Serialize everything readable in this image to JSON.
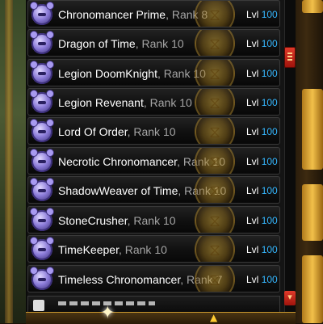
{
  "friends_list": {
    "items": [
      {
        "name": "Chronomancer Prime",
        "rank": "Rank 8",
        "level_label": "Lvl",
        "level": "100"
      },
      {
        "name": "Dragon of Time",
        "rank": "Rank 10",
        "level_label": "Lvl",
        "level": "100"
      },
      {
        "name": "Legion DoomKnight",
        "rank": "Rank 10",
        "level_label": "Lvl",
        "level": "100"
      },
      {
        "name": "Legion Revenant",
        "rank": "Rank 10",
        "level_label": "Lvl",
        "level": "100"
      },
      {
        "name": "Lord Of Order",
        "rank": "Rank 10",
        "level_label": "Lvl",
        "level": "100"
      },
      {
        "name": "Necrotic Chronomancer",
        "rank": "Rank 10",
        "level_label": "Lvl",
        "level": "100"
      },
      {
        "name": "ShadowWeaver of Time",
        "rank": "Rank 10",
        "level_label": "Lvl",
        "level": "100"
      },
      {
        "name": "StoneCrusher",
        "rank": "Rank 10",
        "level_label": "Lvl",
        "level": "100"
      },
      {
        "name": "TimeKeeper",
        "rank": "Rank 10",
        "level_label": "Lvl",
        "level": "100"
      },
      {
        "name": "Timeless Chronomancer",
        "rank": "Rank 7",
        "level_label": "Lvl",
        "level": "100"
      }
    ],
    "separator": ", ",
    "avatar_icon": "class-helm-icon",
    "emblem_icon": "hourglass-emblem-icon"
  },
  "colors": {
    "name_text": "#ffffff",
    "rank_text": "#a6a6a6",
    "level_value": "#35b7ff",
    "scrollbar_accent": "#e03a2a",
    "frame_gold": "#c9982f"
  }
}
